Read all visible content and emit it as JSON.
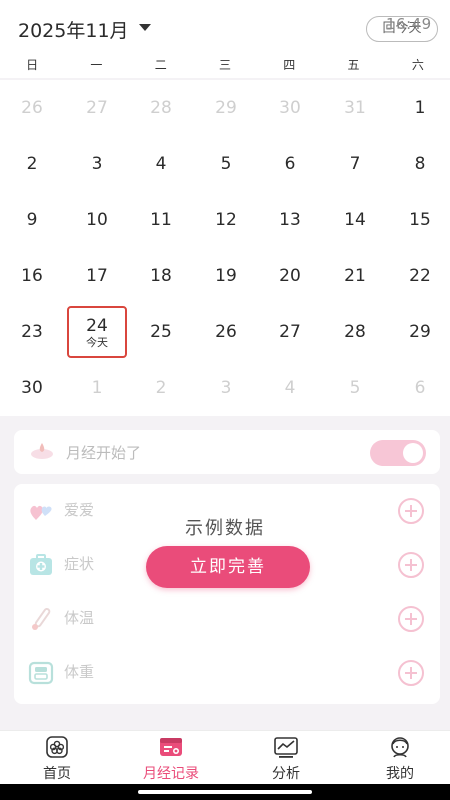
{
  "header": {
    "month_title": "2025年11月",
    "today_button": "回今天",
    "clock": "16:49"
  },
  "weekdays": [
    "日",
    "一",
    "二",
    "三",
    "四",
    "五",
    "六"
  ],
  "calendar": {
    "rows": [
      [
        {
          "d": "26",
          "muted": true
        },
        {
          "d": "27",
          "muted": true
        },
        {
          "d": "28",
          "muted": true
        },
        {
          "d": "29",
          "muted": true
        },
        {
          "d": "30",
          "muted": true
        },
        {
          "d": "31",
          "muted": true
        },
        {
          "d": "1",
          "muted": false
        }
      ],
      [
        {
          "d": "2",
          "muted": false
        },
        {
          "d": "3",
          "muted": false
        },
        {
          "d": "4",
          "muted": false
        },
        {
          "d": "5",
          "muted": false
        },
        {
          "d": "6",
          "muted": false
        },
        {
          "d": "7",
          "muted": false
        },
        {
          "d": "8",
          "muted": false
        }
      ],
      [
        {
          "d": "9",
          "muted": false
        },
        {
          "d": "10",
          "muted": false
        },
        {
          "d": "11",
          "muted": false
        },
        {
          "d": "12",
          "muted": false
        },
        {
          "d": "13",
          "muted": false
        },
        {
          "d": "14",
          "muted": false
        },
        {
          "d": "15",
          "muted": false
        }
      ],
      [
        {
          "d": "16",
          "muted": false
        },
        {
          "d": "17",
          "muted": false
        },
        {
          "d": "18",
          "muted": false
        },
        {
          "d": "19",
          "muted": false
        },
        {
          "d": "20",
          "muted": false
        },
        {
          "d": "21",
          "muted": false
        },
        {
          "d": "22",
          "muted": false
        }
      ],
      [
        {
          "d": "23",
          "muted": false
        },
        {
          "d": "24",
          "muted": false,
          "today": true
        },
        {
          "d": "25",
          "muted": false
        },
        {
          "d": "26",
          "muted": false
        },
        {
          "d": "27",
          "muted": false
        },
        {
          "d": "28",
          "muted": false
        },
        {
          "d": "29",
          "muted": false
        }
      ],
      [
        {
          "d": "30",
          "muted": false
        },
        {
          "d": "1",
          "muted": true
        },
        {
          "d": "2",
          "muted": true
        },
        {
          "d": "3",
          "muted": true
        },
        {
          "d": "4",
          "muted": true
        },
        {
          "d": "5",
          "muted": true
        },
        {
          "d": "6",
          "muted": true
        }
      ]
    ],
    "today_label": "今天"
  },
  "period": {
    "label": "月经开始了",
    "toggle_on": true
  },
  "records": [
    {
      "label": "爱爱",
      "icon": "hearts-icon"
    },
    {
      "label": "症状",
      "icon": "medkit-icon"
    },
    {
      "label": "体温",
      "icon": "thermometer-icon"
    },
    {
      "label": "体重",
      "icon": "scale-icon"
    }
  ],
  "overlay": {
    "title": "示例数据",
    "cta": "立即完善"
  },
  "tabbar": [
    {
      "label": "首页",
      "icon": "flower-home-icon",
      "active": false
    },
    {
      "label": "月经记录",
      "icon": "period-record-icon",
      "active": true
    },
    {
      "label": "分析",
      "icon": "chart-analysis-icon",
      "active": false
    },
    {
      "label": "我的",
      "icon": "profile-icon",
      "active": false
    }
  ],
  "colors": {
    "accent": "#ea4c7a",
    "today_border": "#d9463d",
    "toggle": "#f7c6d6"
  }
}
